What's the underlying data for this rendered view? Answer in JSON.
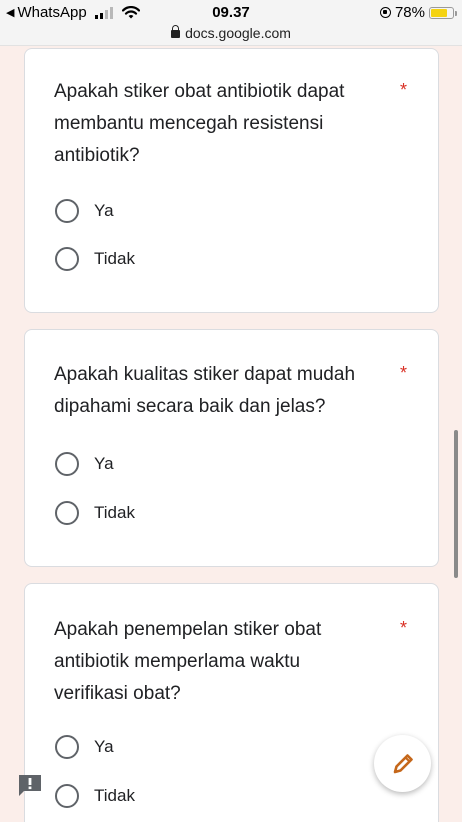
{
  "status_bar": {
    "back_app": "WhatsApp",
    "time": "09.37",
    "url": "docs.google.com",
    "battery": "78%",
    "battery_level": 0.78,
    "battery_color": "#f5d312"
  },
  "questions": [
    {
      "text": "Apakah stiker obat antibiotik dapat membantu mencegah resistensi antibiotik?",
      "required_mark": "*",
      "options": [
        "Ya",
        "Tidak"
      ]
    },
    {
      "text": "Apakah kualitas stiker dapat mudah dipahami secara baik dan jelas?",
      "required_mark": "*",
      "options": [
        "Ya",
        "Tidak"
      ]
    },
    {
      "text": "Apakah penempelan stiker obat antibiotik memperlama waktu verifikasi obat?",
      "required_mark": "*",
      "options": [
        "Ya",
        "Tidak"
      ]
    }
  ],
  "icons": {
    "edit": "pencil-icon",
    "feedback": "report-icon",
    "lock": "lock-icon"
  },
  "colors": {
    "background": "#fbeeea",
    "required": "#d93025",
    "pencil": "#c5671a"
  }
}
